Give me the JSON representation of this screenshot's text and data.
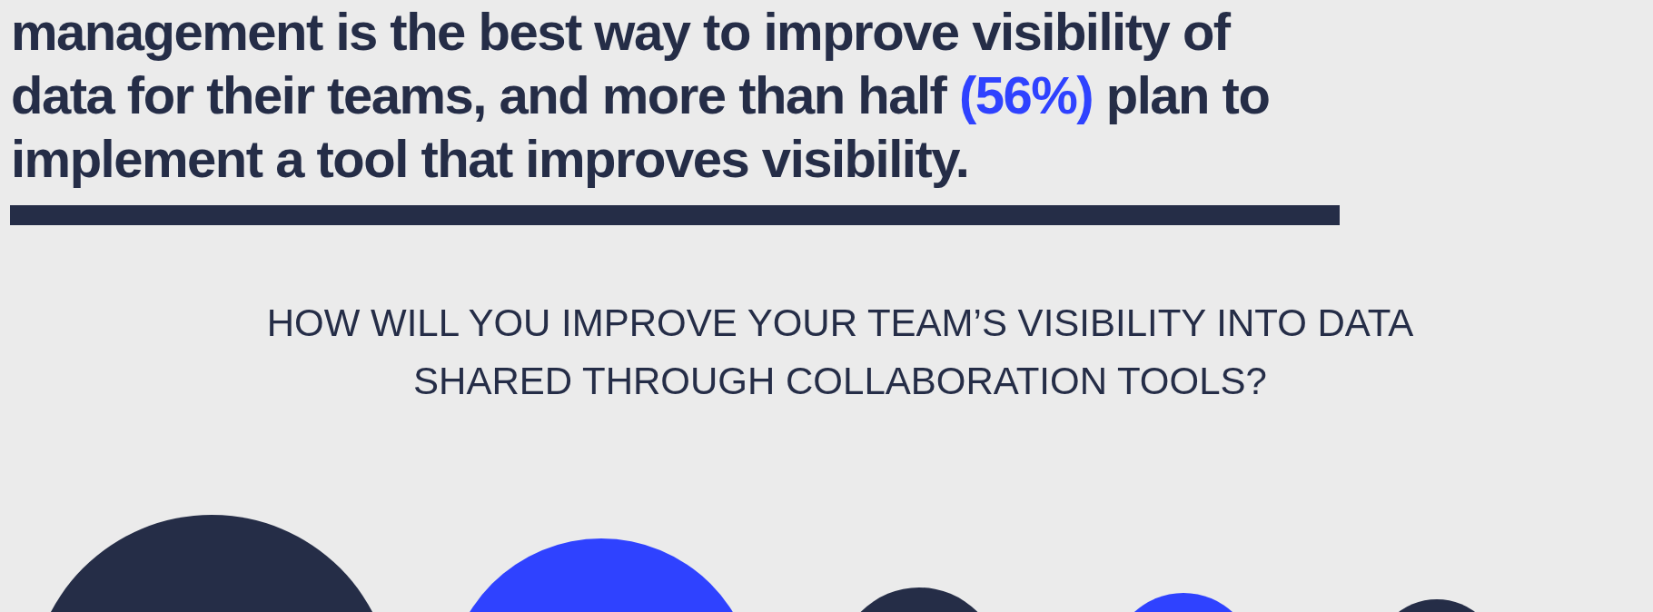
{
  "statement": {
    "text_before": "management is the best way to improve visibility of data for their teams, and more than half ",
    "highlight": "(56%)",
    "text_after": " plan to implement a tool that improves visibility."
  },
  "question": {
    "lines": [
      "HOW WILL YOU IMPROVE YOUR TEAM’S VISIBILITY INTO DATA",
      "SHARED THROUGH COLLABORATION TOOLS?"
    ]
  },
  "bubbles": [
    {
      "color": "#252d47"
    },
    {
      "color": "#2f42ff"
    },
    {
      "color": "#252d47"
    },
    {
      "color": "#2f42ff"
    },
    {
      "color": "#252d47"
    }
  ]
}
